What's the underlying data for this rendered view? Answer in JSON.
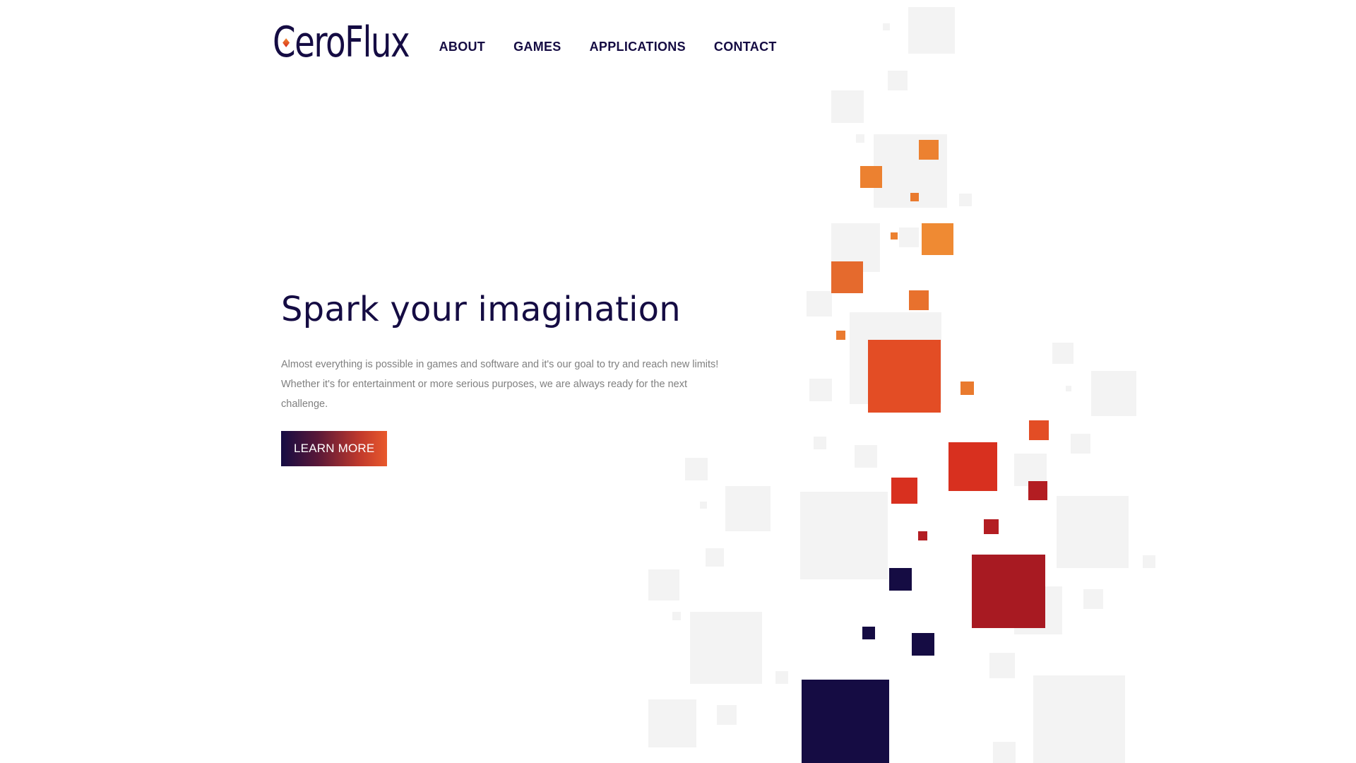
{
  "brand": {
    "logo_text": "CeroFlux",
    "primary_color": "#150c43",
    "accent_orange": "#e9812e",
    "accent_red": "#d5301f",
    "accent_crimson": "#a61a22"
  },
  "nav": {
    "items": [
      {
        "label": "ABOUT"
      },
      {
        "label": "GAMES"
      },
      {
        "label": "APPLICATIONS"
      },
      {
        "label": "CONTACT"
      }
    ]
  },
  "hero": {
    "title": "Spark your imagination",
    "description": "Almost everything is possible in games and software and it's our goal to try and reach new limits! Whether it's for entertainment or more serious purposes, we are always ready for the next challenge.",
    "button_label": "LEARN MORE"
  }
}
